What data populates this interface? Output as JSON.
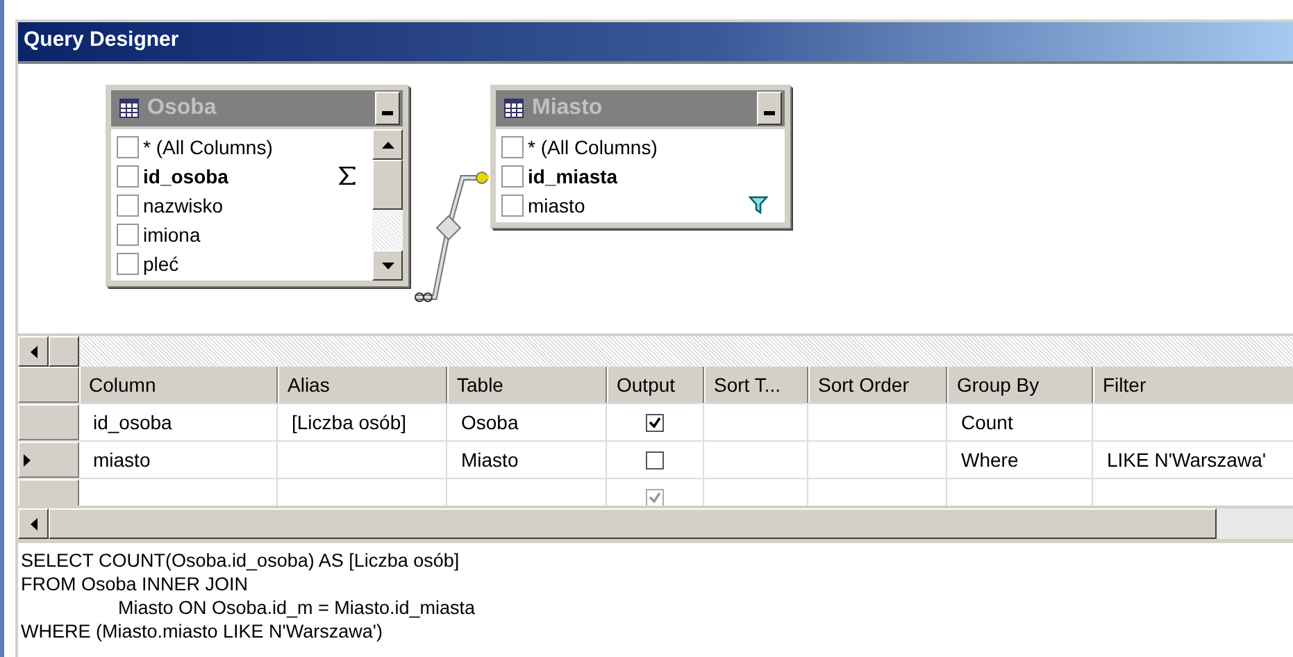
{
  "window": {
    "title": "Query Designer"
  },
  "diagram": {
    "tables": [
      {
        "name": "Osoba",
        "scrollable": true,
        "columns": [
          {
            "name": "* (All Columns)",
            "checked": false,
            "key": false,
            "kind": "plain"
          },
          {
            "name": "id_osoba",
            "checked": false,
            "key": true,
            "kind": "aggregate"
          },
          {
            "name": "nazwisko",
            "checked": false,
            "key": false,
            "kind": "plain"
          },
          {
            "name": "imiona",
            "checked": false,
            "key": false,
            "kind": "plain"
          },
          {
            "name": "pleć",
            "checked": false,
            "key": false,
            "kind": "plain"
          }
        ]
      },
      {
        "name": "Miasto",
        "scrollable": false,
        "columns": [
          {
            "name": "* (All Columns)",
            "checked": false,
            "key": false,
            "kind": "plain"
          },
          {
            "name": "id_miasta",
            "checked": false,
            "key": true,
            "kind": "plain"
          },
          {
            "name": "miasto",
            "checked": false,
            "key": false,
            "kind": "filter"
          }
        ]
      }
    ]
  },
  "grid": {
    "columns": [
      "Column",
      "Alias",
      "Table",
      "Output",
      "Sort T...",
      "Sort Order",
      "Group By",
      "Filter"
    ],
    "rows": [
      {
        "column": "id_osoba",
        "alias": "[Liczba osób]",
        "table": "Osoba",
        "output": true,
        "group_by": "Count",
        "selected": false,
        "disabled": false
      },
      {
        "column": "miasto",
        "table": "Miasto",
        "output": false,
        "group_by": "Where",
        "filter": "LIKE N'Warszawa'",
        "selected": true,
        "disabled": false
      },
      {
        "output": true,
        "selected": false,
        "disabled": true
      }
    ]
  },
  "sql": [
    {
      "text": "SELECT COUNT(Osoba.id_osoba) AS [Liczba osób]",
      "kind": "clause"
    },
    {
      "text": "FROM  Osoba INNER JOIN",
      "kind": "clause"
    },
    {
      "text": "Miasto ON Osoba.id_m = Miasto.id_miasta",
      "kind": "continuation"
    },
    {
      "text": "WHERE (Miasto.miasto LIKE N'Warszawa')",
      "kind": "clause"
    }
  ]
}
